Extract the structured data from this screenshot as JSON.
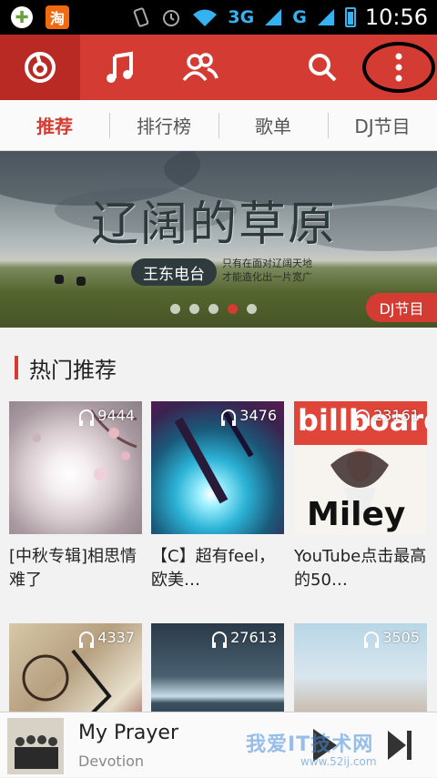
{
  "status_bar": {
    "app1": "✚",
    "app2": "淘",
    "network1": "3G",
    "network2": "G",
    "time": "10:56"
  },
  "top_nav": {
    "icons": [
      "netease-logo-icon",
      "music-note-icon",
      "friends-icon",
      "search-icon",
      "more-vertical-icon"
    ],
    "accent_color": "#d43c33"
  },
  "tabs": [
    {
      "label": "推荐",
      "active": true
    },
    {
      "label": "排行榜",
      "active": false
    },
    {
      "label": "歌单",
      "active": false
    },
    {
      "label": "DJ节目",
      "active": false
    }
  ],
  "banner": {
    "title": "辽阔的草原",
    "badge": "王东电台",
    "sub_line1": "只有在面对辽阔天地",
    "sub_line2": "才能造化出一片宽广",
    "tag": "DJ节目",
    "dot_count": 5,
    "active_dot": 3
  },
  "section": {
    "title": "热门推荐"
  },
  "playlists": [
    {
      "count": "9444",
      "title": "[中秋专辑]相思情难了"
    },
    {
      "count": "3476",
      "title": "【C】超有feel，欧美…"
    },
    {
      "count": "23161",
      "title": "YouTube点击最高的50…"
    },
    {
      "count": "4337",
      "title": ""
    },
    {
      "count": "27613",
      "title": ""
    },
    {
      "count": "3505",
      "title": ""
    }
  ],
  "covers_text": {
    "billboard": "billboard",
    "miley": "Miley"
  },
  "player": {
    "title": "My Prayer",
    "artist": "Devotion"
  },
  "watermark": {
    "line1": "我爱IT技术网",
    "line2": "www.52ij.com"
  }
}
